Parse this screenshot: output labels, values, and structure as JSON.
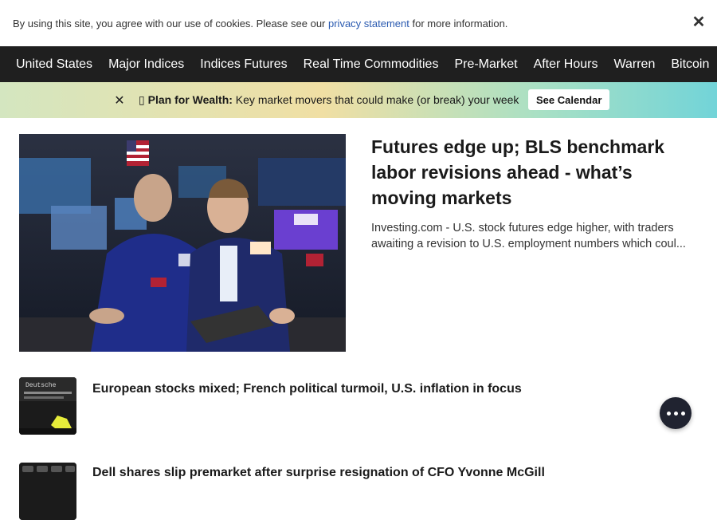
{
  "cookie": {
    "text_before": "By using this site, you agree with our use of cookies. Please see our ",
    "link_text": "privacy statement",
    "text_after": " for more information.",
    "close_glyph": "✕"
  },
  "nav": {
    "items": [
      "United States",
      "Major Indices",
      "Indices Futures",
      "Real Time Commodities",
      "Pre-Market",
      "After Hours",
      "Warren",
      "Bitcoin"
    ]
  },
  "promo": {
    "close_glyph": "✕",
    "icon_glyph": "▯",
    "bold_text": "Plan for Wealth:",
    "text": " Key market movers that could make (or break) your week",
    "button_label": "See Calendar"
  },
  "hero": {
    "title": "Futures edge up; BLS benchmark labor revisions ahead - what’s moving markets",
    "summary": "Investing.com - U.S. stock futures edge higher, with traders awaiting a revision to U.S. employment numbers which coul..."
  },
  "articles": [
    {
      "title": "European stocks mixed; French political turmoil, U.S. inflation in focus",
      "thumb_text": "Deutsche"
    },
    {
      "title": "Dell shares slip premarket after surprise resignation of CFO Yvonne McGill",
      "thumb_text": ""
    }
  ],
  "colors": {
    "nav_bg": "#1f1f1f",
    "link": "#2a5ab0",
    "fab_bg": "#202330"
  }
}
